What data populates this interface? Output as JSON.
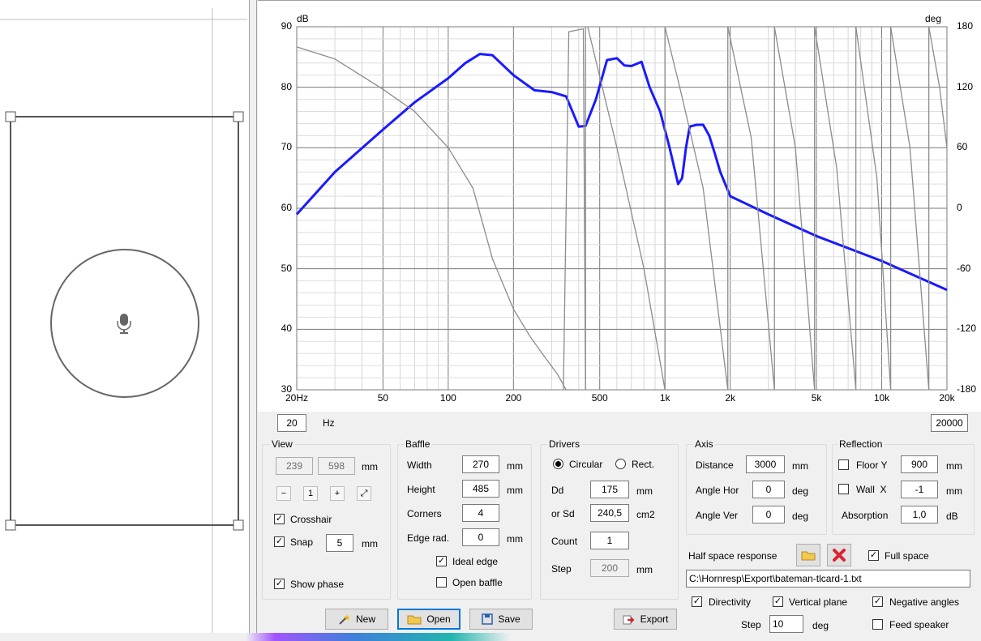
{
  "chart": {
    "unit_left": "dB",
    "unit_right": "deg",
    "y_left_ticks": [
      "90",
      "80",
      "70",
      "60",
      "50",
      "40",
      "30"
    ],
    "y_right_ticks": [
      "180",
      "120",
      "60",
      "0",
      "-60",
      "-120",
      "-180"
    ],
    "x_ticks": [
      "20Hz",
      "50",
      "100",
      "200",
      "500",
      "1k",
      "2k",
      "5k",
      "10k",
      "20k"
    ],
    "range_min": "20",
    "range_unit": "Hz",
    "range_max": "20000"
  },
  "chart_data": {
    "type": "line",
    "x_scale": "log",
    "xlim": [
      20,
      20000
    ],
    "ylim_left": [
      30,
      90
    ],
    "ylim_right": [
      -180,
      180
    ],
    "x_tick_values": [
      20,
      50,
      100,
      200,
      500,
      1000,
      2000,
      5000,
      10000,
      20000
    ],
    "series": [
      {
        "axis": "left",
        "color": "#1a1aff",
        "x": [
          20,
          30,
          50,
          70,
          100,
          120,
          140,
          160,
          200,
          250,
          300,
          350,
          400,
          430,
          480,
          540,
          600,
          650,
          700,
          780,
          850,
          950,
          1050,
          1150,
          1200,
          1250,
          1300,
          1400,
          1500,
          1600,
          1700,
          1800,
          2000,
          3000,
          5000,
          10000,
          20000
        ],
        "y": [
          59,
          66,
          73,
          77.5,
          81.5,
          84,
          85.5,
          85.3,
          82,
          79.5,
          79.2,
          78.5,
          73.5,
          73.6,
          78,
          84.5,
          84.8,
          83.6,
          83.5,
          84.2,
          80,
          76,
          70,
          64,
          65,
          70,
          73.5,
          73.8,
          73.8,
          72,
          69,
          66,
          62,
          59,
          55.4,
          51.3,
          46.5
        ]
      },
      {
        "axis": "right",
        "color": "#8c8c8c",
        "x": [
          20,
          30,
          50,
          70,
          100,
          130,
          160,
          200,
          240,
          280,
          320,
          350,
          380
        ],
        "y": [
          160,
          148,
          118,
          96,
          60,
          20,
          -50,
          -100,
          -128,
          -148,
          -165,
          -180,
          -180
        ]
      }
    ]
  },
  "view": {
    "title": "View",
    "width": "239",
    "height": "598",
    "unit": "mm",
    "crosshair_label": "Crosshair",
    "snap_label": "Snap",
    "snap_value": "5",
    "snap_unit": "mm",
    "show_phase_label": "Show phase"
  },
  "baffle": {
    "title": "Baffle",
    "width_label": "Width",
    "width_value": "270",
    "width_unit": "mm",
    "height_label": "Height",
    "height_value": "485",
    "height_unit": "mm",
    "corners_label": "Corners",
    "corners_value": "4",
    "edge_label": "Edge rad.",
    "edge_value": "0",
    "edge_unit": "mm",
    "ideal_edge_label": "Ideal edge",
    "open_baffle_label": "Open baffle"
  },
  "drivers": {
    "title": "Drivers",
    "circular_label": "Circular",
    "rect_label": "Rect.",
    "dd_label": "Dd",
    "dd_value": "175",
    "dd_unit": "mm",
    "sd_label": "or Sd",
    "sd_value": "240,5",
    "sd_unit": "cm2",
    "count_label": "Count",
    "count_value": "1",
    "step_label": "Step",
    "step_value": "200",
    "step_unit": "mm"
  },
  "axis": {
    "title": "Axis",
    "distance_label": "Distance",
    "distance_value": "3000",
    "distance_unit": "mm",
    "angle_hor_label": "Angle Hor",
    "angle_hor_value": "0",
    "angle_hor_unit": "deg",
    "angle_ver_label": "Angle Ver",
    "angle_ver_value": "0",
    "angle_ver_unit": "deg"
  },
  "reflection": {
    "title": "Reflection",
    "floor_label": "Floor Y",
    "floor_value": "900",
    "floor_unit": "mm",
    "wall_label": "Wall  X",
    "wall_value": "-1",
    "wall_unit": "mm",
    "absorption_label": "Absorption",
    "absorption_value": "1,0",
    "absorption_unit": "dB"
  },
  "half_space": {
    "label": "Half space response",
    "full_space_label": "Full space",
    "path": "C:\\Hornresp\\Export\\bateman-tlcard-1.txt"
  },
  "options": {
    "directivity_label": "Directivity",
    "vertical_plane_label": "Vertical plane",
    "negative_angles_label": "Negative angles",
    "step_label": "Step",
    "step_value": "10",
    "step_unit": "deg",
    "feed_speaker_label": "Feed speaker"
  },
  "toolbar": {
    "new_label": "New",
    "open_label": "Open",
    "save_label": "Save",
    "export_label": "Export"
  }
}
